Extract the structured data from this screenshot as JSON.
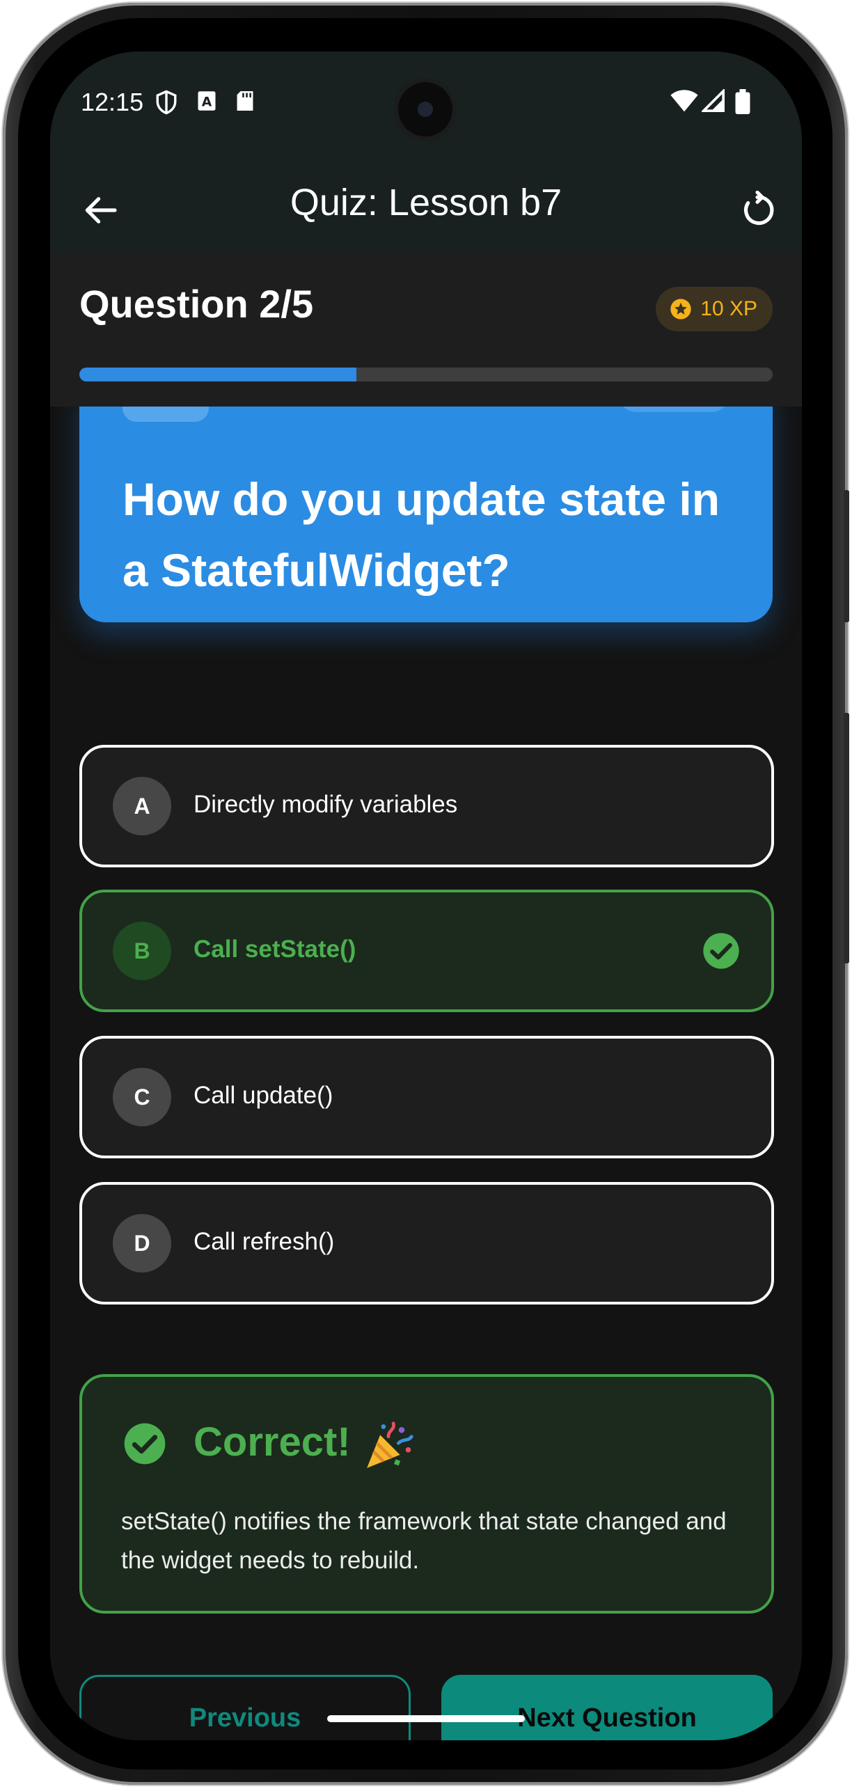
{
  "status_bar": {
    "time": "12:15",
    "icons": [
      "shield-icon",
      "font-a-icon",
      "sd-card-icon",
      "wifi-icon",
      "cell-signal-icon",
      "battery-icon"
    ]
  },
  "app_bar": {
    "title": "Quiz: Lesson b7",
    "back_icon": "arrow-left-icon",
    "refresh_icon": "refresh-icon"
  },
  "quiz": {
    "question_counter": "Question 2/5",
    "xp_badge": "10 XP",
    "progress": 0.4,
    "question": "How do you update state in a StatefulWidget?",
    "options": [
      {
        "letter": "A",
        "label": "Directly modify variables",
        "state": "default"
      },
      {
        "letter": "B",
        "label": "Call setState()",
        "state": "correct"
      },
      {
        "letter": "C",
        "label": "Call update()",
        "state": "default"
      },
      {
        "letter": "D",
        "label": "Call refresh()",
        "state": "default"
      }
    ],
    "feedback": {
      "title": "Correct!",
      "emoji": "party-popper-icon",
      "text": "setState() notifies the framework that state changed and the widget needs to rebuild."
    }
  },
  "navigation": {
    "previous_label": "Previous",
    "next_label": "Next Question"
  },
  "colors": {
    "primary_blue": "#2b8ce3",
    "correct_green": "#4caf50",
    "teal": "#0c8a7c",
    "xp_gold": "#f6b21a"
  }
}
